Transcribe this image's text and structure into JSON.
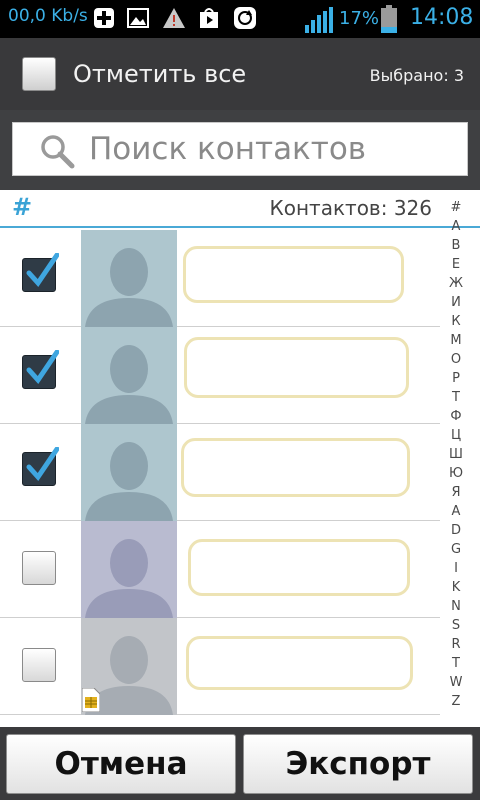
{
  "statusbar": {
    "network_speed": "00,0 Kb/s",
    "battery_percent": "17%",
    "time": "14:08",
    "icons": [
      "add-box-icon",
      "image-icon",
      "warning-icon",
      "play-store-icon",
      "sync-icon",
      "signal-icon",
      "battery-icon"
    ]
  },
  "header": {
    "select_all_label": "Отметить все",
    "selected_count": "Выбрано: 3"
  },
  "search": {
    "placeholder": "Поиск контактов"
  },
  "section": {
    "letter": "#",
    "count_label": "Контактов: 326"
  },
  "contacts": [
    {
      "checked": true,
      "avatar_color": "#aec6ce",
      "sim": false
    },
    {
      "checked": true,
      "avatar_color": "#aec6ce",
      "sim": false
    },
    {
      "checked": true,
      "avatar_color": "#aec6ce",
      "sim": false
    },
    {
      "checked": false,
      "avatar_color": "#b9bbd0",
      "sim": false
    },
    {
      "checked": false,
      "avatar_color": "#c2c5c9",
      "sim": true
    }
  ],
  "alphabet": [
    "#",
    "A",
    "B",
    "E",
    "Ж",
    "И",
    "К",
    "М",
    "О",
    "Р",
    "Т",
    "Ф",
    "Ц",
    "Ш",
    "Ю",
    "Я",
    "A",
    "D",
    "G",
    "I",
    "K",
    "N",
    "S",
    "R",
    "T",
    "W",
    "Z"
  ],
  "buttons": {
    "cancel": "Отмена",
    "export": "Экспорт"
  },
  "colors": {
    "accent": "#3bb0e6",
    "header_bg": "#39393b",
    "name_box_border": "#ede3b4"
  }
}
